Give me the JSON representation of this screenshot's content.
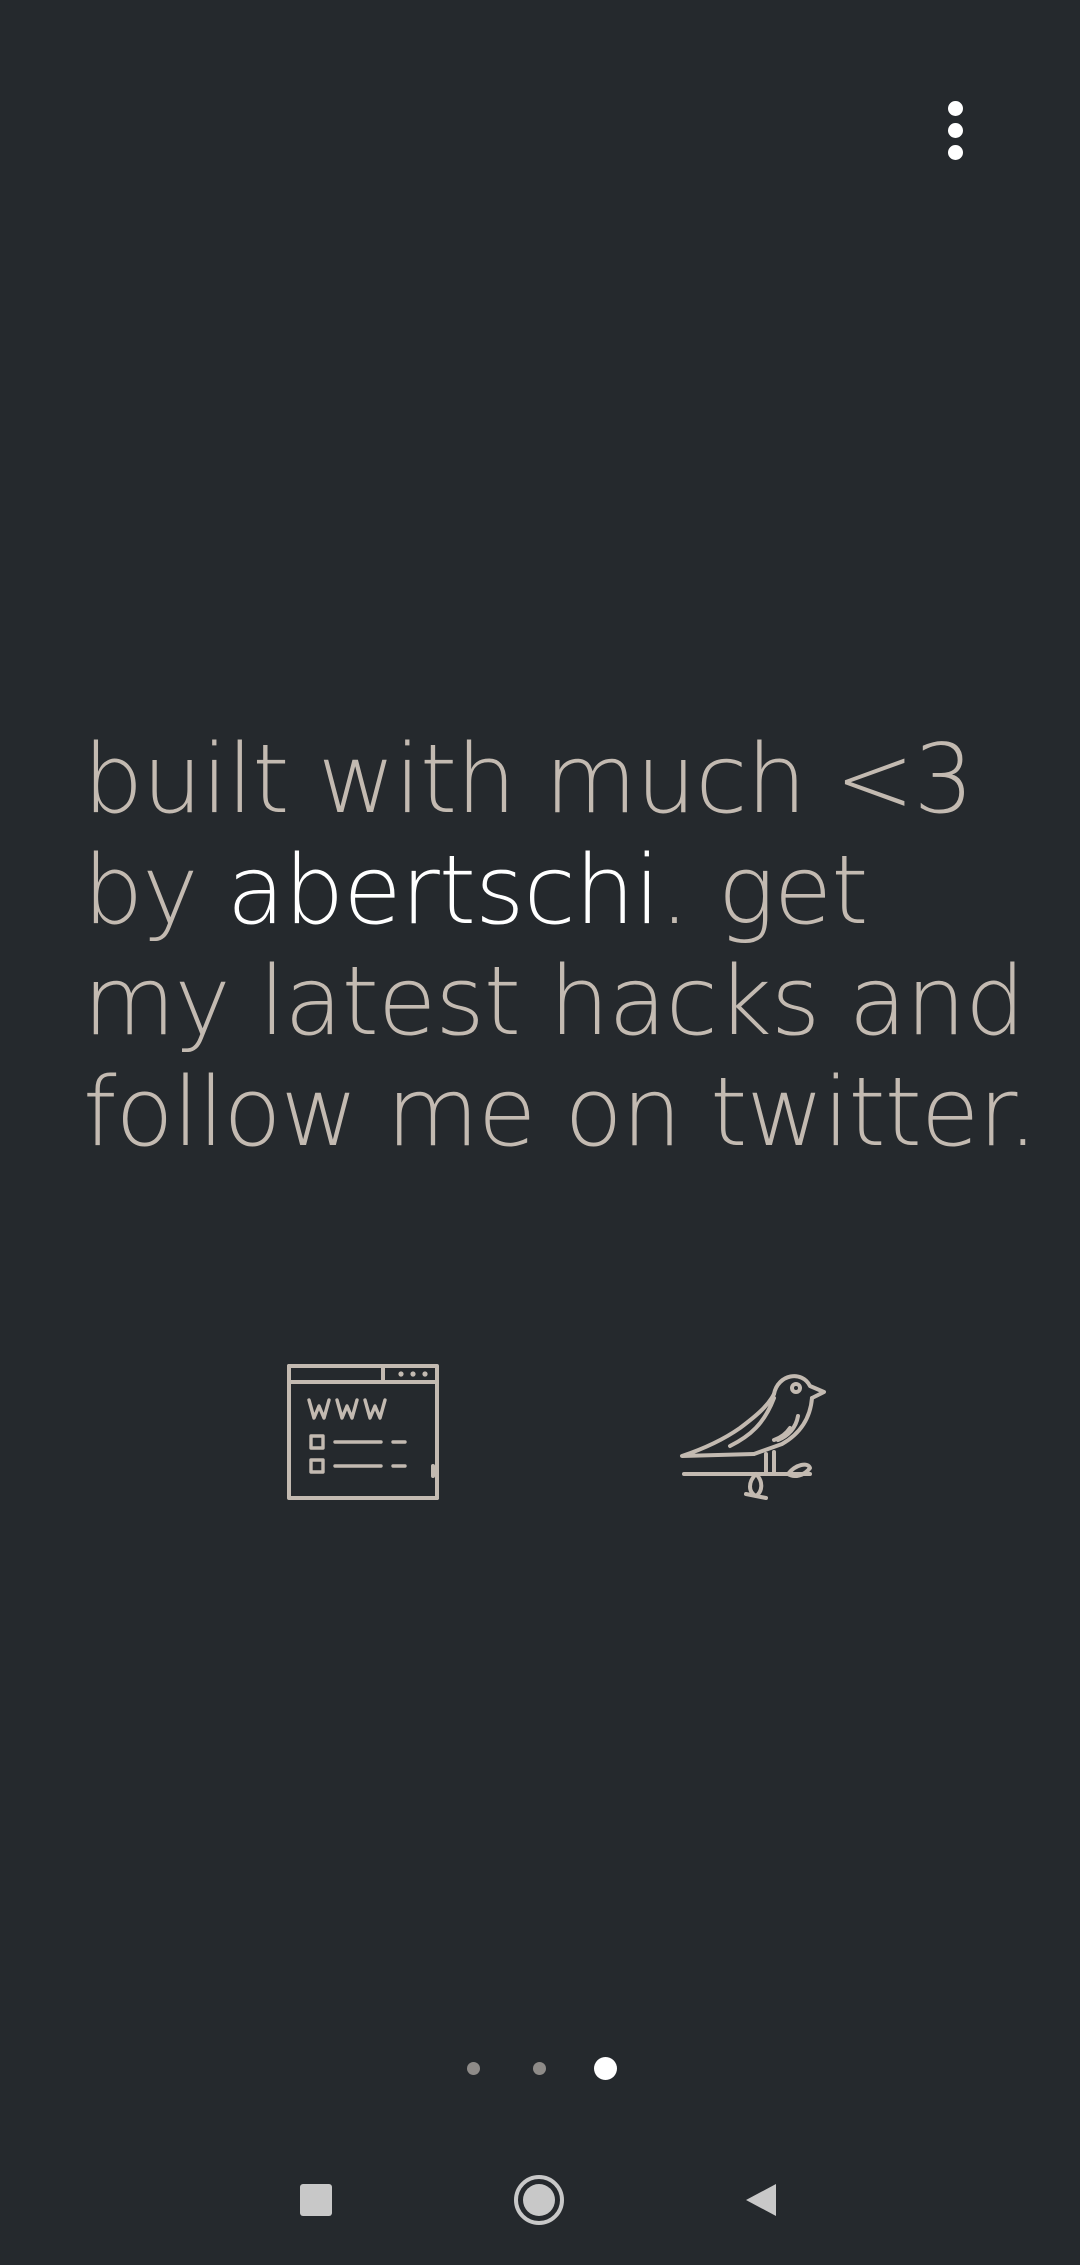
{
  "menu": {
    "icon": "more-vert-icon",
    "color": "#ffffff"
  },
  "headline": {
    "line1": "built with much <3",
    "line2_prefix": "by ",
    "author": "abertschi",
    "line2_suffix": ". get",
    "line3": "my latest hacks and",
    "line4": "follow me on twitter."
  },
  "links": [
    {
      "name": "website",
      "icon": "www-browser-icon"
    },
    {
      "name": "twitter",
      "icon": "bird-icon"
    }
  ],
  "pager": {
    "count": 3,
    "active_index": 2
  },
  "navbar": {
    "recents_icon": "square-icon",
    "home_icon": "circle-icon",
    "back_icon": "triangle-back-icon"
  },
  "colors": {
    "background": "#25292d",
    "text": "#c3bab1",
    "highlight": "#ffffff",
    "icon_stroke": "#c3bab1"
  }
}
